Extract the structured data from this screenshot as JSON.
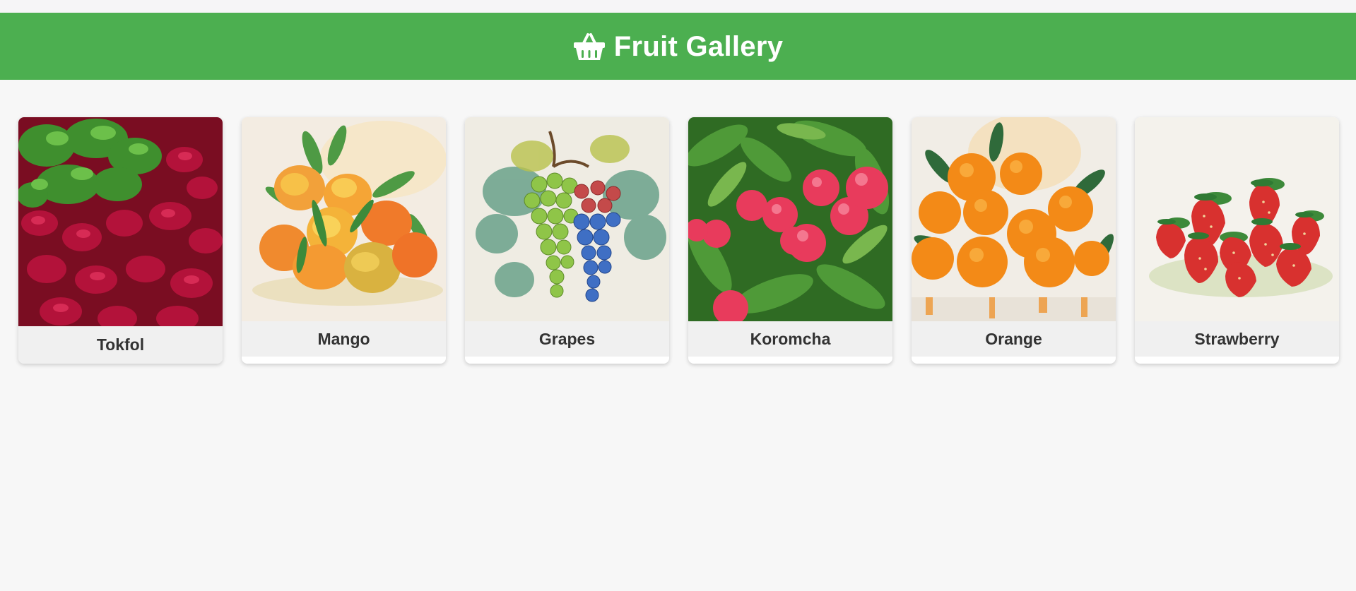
{
  "header": {
    "title": "Fruit Gallery",
    "icon": "basket-icon",
    "background": "#4caf50"
  },
  "gallery": {
    "items": [
      {
        "label": "Tokfol",
        "image": "tokfol-image"
      },
      {
        "label": "Mango",
        "image": "mango-image"
      },
      {
        "label": "Grapes",
        "image": "grapes-image"
      },
      {
        "label": "Koromcha",
        "image": "koromcha-image"
      },
      {
        "label": "Orange",
        "image": "orange-image"
      },
      {
        "label": "Strawberry",
        "image": "strawberry-image"
      }
    ]
  }
}
